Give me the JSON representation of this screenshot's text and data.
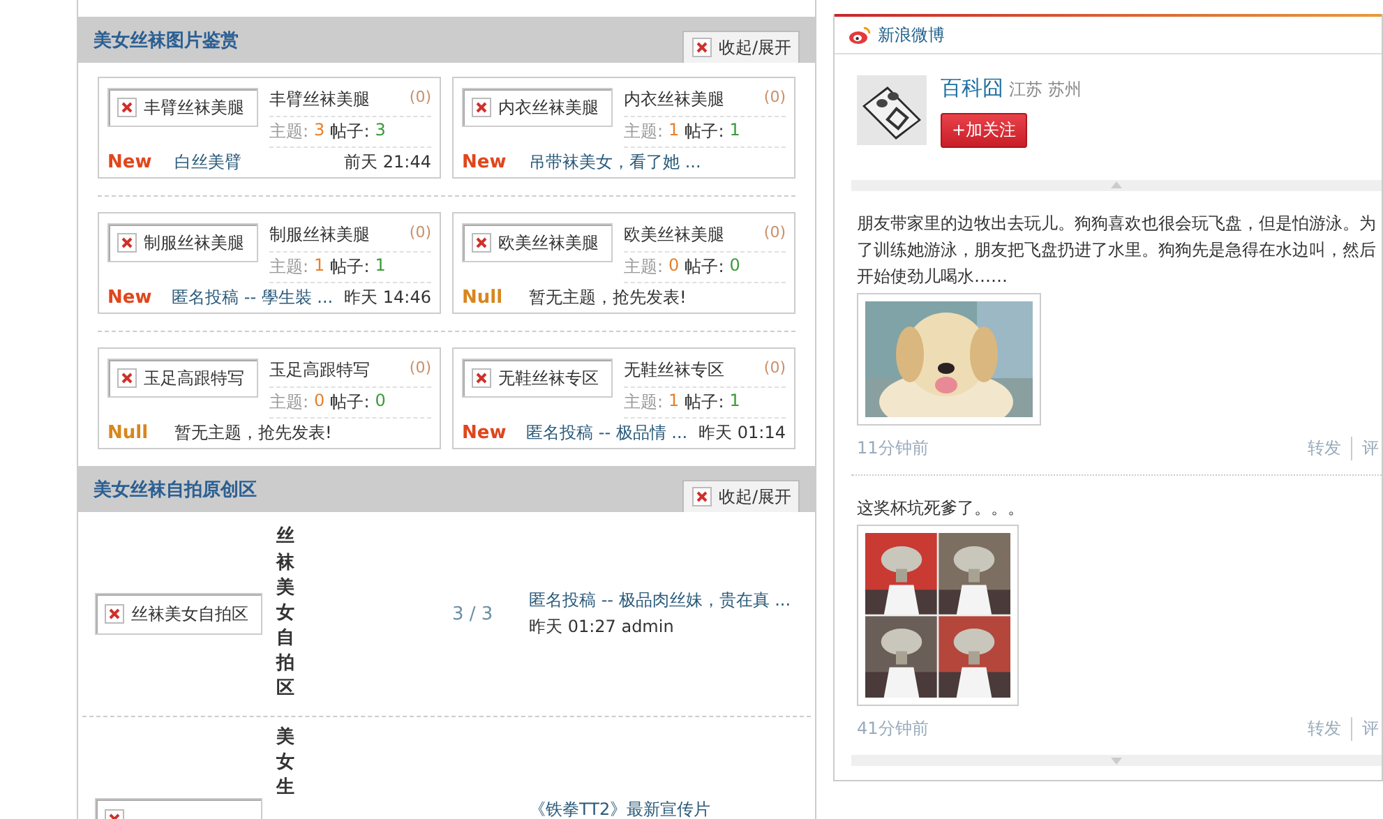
{
  "forum_sections": [
    {
      "title": "美女丝袜图片鉴赏",
      "toggle": "收起/展开",
      "kind": "grid",
      "boards": [
        {
          "kind": "new",
          "image_alt": "丰臂丝袜美腿",
          "name": "丰臂丝袜美腿",
          "today": "(0)",
          "topics_label": "主题:",
          "topics": "3",
          "posts_label": "帖子:",
          "posts": "3",
          "status": "New",
          "last_post": "白丝美臂",
          "time": "前天 21:44"
        },
        {
          "kind": "new",
          "image_alt": "内衣丝袜美腿",
          "name": "内衣丝袜美腿",
          "today": "(0)",
          "topics_label": "主题:",
          "topics": "1",
          "posts_label": "帖子:",
          "posts": "1",
          "status": "New",
          "last_post": "吊带袜美女，看了她 ..."
        },
        {
          "kind": "new",
          "image_alt": "制服丝袜美腿",
          "name": "制服丝袜美腿",
          "today": "(0)",
          "topics_label": "主题:",
          "topics": "1",
          "posts_label": "帖子:",
          "posts": "1",
          "status": "New",
          "last_post": "匿名投稿 -- 學生裝 ...",
          "time": "昨天 14:46"
        },
        {
          "kind": "empty",
          "image_alt": "欧美丝袜美腿",
          "name": "欧美丝袜美腿",
          "today": "(0)",
          "topics_label": "主题:",
          "topics": "0",
          "posts_label": "帖子:",
          "posts": "0",
          "status": "Null",
          "note": "暂无主题，抢先发表!"
        },
        {
          "kind": "empty",
          "image_alt": "玉足高跟特写",
          "name": "玉足高跟特写",
          "today": "(0)",
          "topics_label": "主题:",
          "topics": "0",
          "posts_label": "帖子:",
          "posts": "0",
          "status": "Null",
          "note": "暂无主题，抢先发表!"
        },
        {
          "kind": "new",
          "image_alt": "无鞋丝袜专区",
          "name": "无鞋丝袜专区",
          "today": "(0)",
          "topics_label": "主题:",
          "topics": "1",
          "posts_label": "帖子:",
          "posts": "1",
          "status": "New",
          "last_post": "匿名投稿 -- 极品情 ...",
          "time": "昨天 01:14"
        }
      ]
    },
    {
      "title": "美女丝袜自拍原创区",
      "toggle": "收起/展开",
      "kind": "list",
      "boards": [
        {
          "image_alt": "丝袜美女自拍区",
          "name": "丝袜美女自拍区",
          "counts": "3 / 3",
          "last_post": "匿名投稿 -- 极品肉丝妹，贵在真 ...",
          "last_info": "昨天 01:27 admin"
        },
        {
          "name": "美女生",
          "last_post": "《铁拳TT2》最新宣传片"
        }
      ]
    }
  ],
  "weibo": {
    "title": "新浪微博",
    "user": {
      "name": "百科囧",
      "location": "江苏 苏州",
      "follow": "+加关注"
    },
    "posts": [
      {
        "text": "朋友带家里的边牧出去玩儿。狗狗喜欢也很会玩飞盘，但是怕游泳。为了训练她游泳，朋友把飞盘扔进了水里。狗狗先是急得在水边叫，然后开始使劲儿喝水……",
        "time": "11分钟前",
        "actions": [
          "转发",
          "评"
        ]
      },
      {
        "text": "这奖杯坑死爹了。。。",
        "time": "41分钟前",
        "actions": [
          "转发",
          "评"
        ]
      }
    ]
  }
}
